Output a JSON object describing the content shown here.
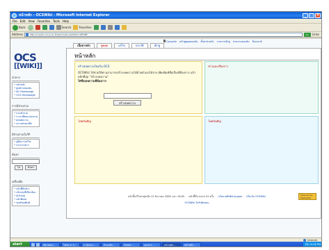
{
  "window": {
    "title": "หน้าหลัก - OCSWiki - Microsoft Internet Explorer",
    "menu": [
      "File",
      "Edit",
      "View",
      "Favorites",
      "Tools",
      "Help"
    ],
    "toolbar": {
      "back_label": "Back",
      "search_label": "Search",
      "favorites_label": "Favorites"
    },
    "address": {
      "label": "Address",
      "url": "http://ocswiki.ocs.ku.ac.th/wiki/index.php?title=หน้าหลัก",
      "go_label": "Go",
      "links_label": "Links"
    }
  },
  "wiki": {
    "logo_top": "OCS",
    "logo_bottom": "[[WIKI]]",
    "user_links": [
      "Cpruphe",
      "หน้าพูดคุยของฉัน",
      "ตั้งค่าส่วนตัว",
      "รายการเฝ้าดู",
      "ส่วนร่วมของฉัน",
      "ล็อกเอาท์"
    ],
    "tabs": [
      {
        "label": "เนื้อหาหลัก",
        "state": "selected"
      },
      {
        "label": "พูดคุย",
        "state": "red"
      },
      {
        "label": "แก้ไข",
        "state": "normal"
      },
      {
        "label": "ประวัติ",
        "state": "normal"
      },
      {
        "label": "เฝ้าดู",
        "state": "normal"
      }
    ],
    "page_title": "หน้าหลัก",
    "sidebar": {
      "navigation_title": "นำทาง",
      "navigation": [
        "หน้าหลัก",
        "ศูนย์รวมชุมชน",
        "KU Homepage",
        "OCS Homepage"
      ],
      "interaction_title": "การมีส่วนร่วม",
      "interaction": [
        "ถามคำถาม",
        "การเปลี่ยนแปลงล่าสุด",
        "สุ่มบทความ",
        "ความช่วยเหลือ"
      ],
      "community_title": "มีส่วนร่วมในวิกิ",
      "community": [
        "คู่มือการแก้ไข",
        "กระดานข่าว"
      ],
      "search_title": "ค้นหา",
      "search_go": "ไป",
      "search_button": "ค้นหา",
      "toolbox_title": "เครื่องมือ",
      "toolbox": [
        "หน้าที่ลิงก์มา",
        "ปรับปรุงที่เกี่ยวข้อง",
        "อัปโหลด",
        "หน้าพิเศษ",
        "รุ่นพร้อมพิมพ์"
      ]
    },
    "welcome": {
      "heading": "สร้างบทความใหม่ใน OCS",
      "text": "OCSWiki ได้ช่วยให้ท่านสามารถสร้างบทความได้ด้วยตัวเองได้ง่าย เพียงพิมพ์ชื่อเรื่องที่ต้องการ แล้วคลิกที่ปุ่ม \"สร้างบทความ\"",
      "prompt": "ใส่ชื่อบทความที่ต้องการ",
      "button": "สร้างบทความ"
    },
    "news_heading": "ข่าวและเรื่องราว",
    "intro_heading": "โดยบังเอิญ",
    "wanted_heading": "โดยบังเอิญ",
    "footer": {
      "modified": "หน้านี้แก้ไขล่าสุดเมื่อ 12 ธันวาคม 2006 เวลา 18:05",
      "views": "หน้านี้มีการอ่าน 52 ครั้ง",
      "privacy": "นโยบายสิทธิส่วนบุคคล",
      "about": "เกี่ยวกับ OCSWiki",
      "disclaimer": "OCSWiki ไม่รับผิดชอบ",
      "powered_top": "Powered by",
      "powered_bottom": "MediaWiki"
    }
  },
  "status": {
    "zone": "Internet"
  },
  "taskbar": {
    "start_label": "start",
    "items": [
      "Window...",
      "ไฟล์งาน S...",
      "C:\\Docu...",
      "ส่วนหลัก...",
      "Home...",
      "เอกสาร...",
      "หน้าหลัก...",
      "หน้าหลัก..."
    ],
    "clock": "EN 10:28 PM"
  }
}
